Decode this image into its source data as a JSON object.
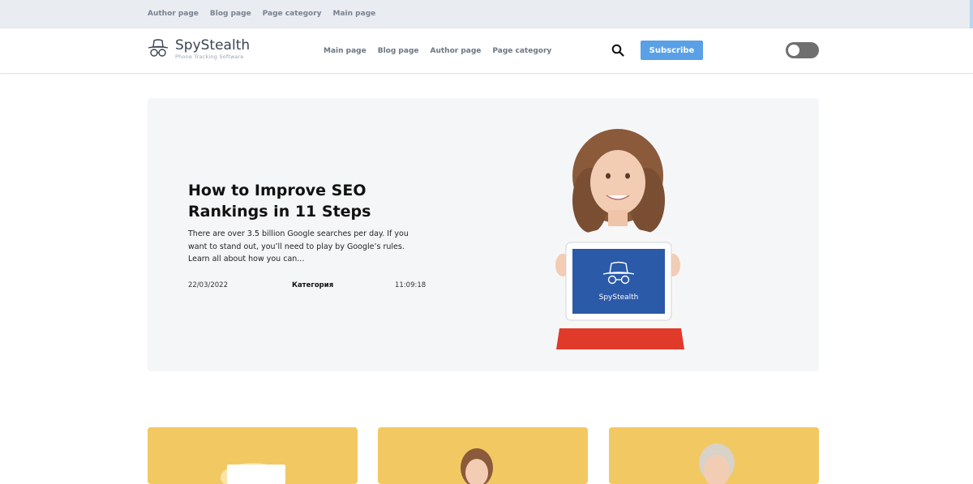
{
  "topbar": {
    "links": [
      "Author page",
      "Blog page",
      "Page category",
      "Main page"
    ]
  },
  "header": {
    "logo_name": "SpyStealth",
    "logo_tagline": "Phone Tracking Software",
    "nav": [
      "Main page",
      "Blog page",
      "Author page",
      "Page category"
    ],
    "search_icon": "search-icon",
    "subscribe_label": "Subscribe",
    "toggle_state": "off"
  },
  "hero": {
    "title": "How to Improve SEO Rankings in 11 Steps",
    "excerpt": "There are over 3.5 billion Google searches per day. If you want to stand out, you’ll need to play by Google’s rules. Learn all about how you can...",
    "date": "22/03/2022",
    "category": "Категория",
    "time": "11:09:18",
    "image_caption": "SpyStealth"
  },
  "colors": {
    "accent": "#5aa0e6",
    "topbar_bg": "#e9edf1",
    "hero_bg": "#f5f6f8",
    "card_bg": "#f2c862"
  }
}
